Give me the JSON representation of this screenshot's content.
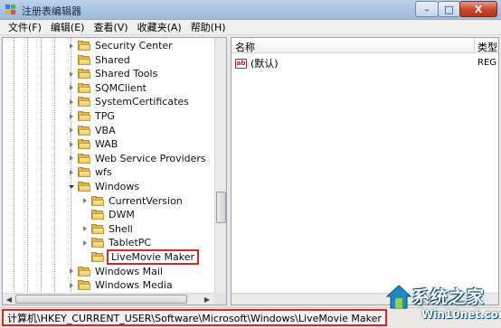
{
  "window": {
    "title": "注册表编辑器",
    "minimize_glyph": "–",
    "maximize_glyph": "□",
    "close_glyph": "X"
  },
  "menu": [
    "文件(F)",
    "编辑(E)",
    "查看(V)",
    "收藏夹(A)",
    "帮助(H)"
  ],
  "tree": {
    "items": [
      {
        "label": "Security Center",
        "expander": "collapsed",
        "level": 1
      },
      {
        "label": "Shared",
        "expander": "none",
        "level": 1
      },
      {
        "label": "Shared Tools",
        "expander": "collapsed",
        "level": 1
      },
      {
        "label": "SQMClient",
        "expander": "collapsed",
        "level": 1
      },
      {
        "label": "SystemCertificates",
        "expander": "collapsed",
        "level": 1
      },
      {
        "label": "TPG",
        "expander": "collapsed",
        "level": 1
      },
      {
        "label": "VBA",
        "expander": "collapsed",
        "level": 1
      },
      {
        "label": "WAB",
        "expander": "collapsed",
        "level": 1
      },
      {
        "label": "Web Service Providers",
        "expander": "collapsed",
        "level": 1
      },
      {
        "label": "wfs",
        "expander": "collapsed",
        "level": 1
      },
      {
        "label": "Windows",
        "expander": "expanded",
        "level": 1
      },
      {
        "label": "CurrentVersion",
        "expander": "collapsed",
        "level": 2
      },
      {
        "label": "DWM",
        "expander": "none",
        "level": 2
      },
      {
        "label": "Shell",
        "expander": "collapsed",
        "level": 2
      },
      {
        "label": "TabletPC",
        "expander": "collapsed",
        "level": 2
      },
      {
        "label": "LiveMovie Maker",
        "expander": "none",
        "level": 2,
        "selected": true
      },
      {
        "label": "Windows Mail",
        "expander": "collapsed",
        "level": 1
      },
      {
        "label": "Windows Media",
        "expander": "collapsed",
        "level": 1
      }
    ]
  },
  "values_pane": {
    "columns": {
      "name": "名称",
      "type": "类型"
    },
    "rows": [
      {
        "name": "(默认)",
        "type": "REG",
        "icon": "ab-string-icon"
      }
    ]
  },
  "statusbar": {
    "path": "计算机\\HKEY_CURRENT_USER\\Software\\Microsoft\\Windows\\LiveMovie Maker"
  },
  "watermark": {
    "title": "系统之家",
    "url": "Win10net.com"
  },
  "colors": {
    "highlight_border": "#d8262b",
    "folder": "#e6b84a",
    "titlebar": "#a8c3e2"
  }
}
